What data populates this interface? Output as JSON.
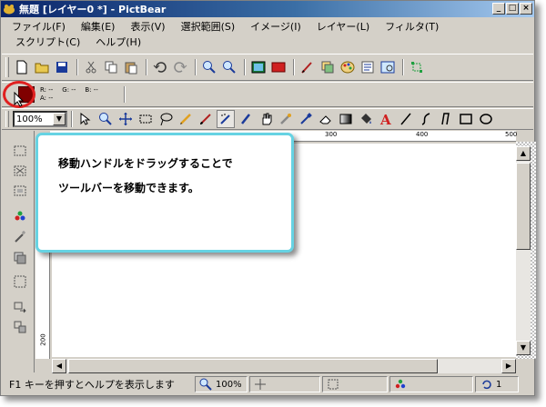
{
  "window": {
    "title": "無題 [レイヤー0 *] - PictBear",
    "buttons": {
      "minimize": "_",
      "maximize": "□",
      "close": "×"
    }
  },
  "menu": [
    "ファイル(F)",
    "編集(E)",
    "表示(V)",
    "選択範囲(S)",
    "イメージ(I)",
    "レイヤー(L)",
    "フィルタ(T)",
    "スクリプト(C)",
    "ヘルプ(H)"
  ],
  "color_panel": {
    "current_color": "#800000",
    "r_label": "R: --",
    "g_label": "G: --",
    "b_label": "B: --",
    "a_label": "A: --"
  },
  "zoom_combo": {
    "value": "100%"
  },
  "callout": {
    "line1": "移動ハンドルをドラッグすることで",
    "line2": "ツールバーを移動できます。"
  },
  "ruler": {
    "ticks": [
      "300",
      "400",
      "500"
    ],
    "vtick": "200"
  },
  "status": {
    "help_text": "F1 キーを押すとヘルプを表示します",
    "zoom": "100%",
    "undo_count": "1"
  },
  "colors": {
    "titlebar_start": "#0a246a",
    "accent_callout": "#66d3e3",
    "highlight": "#e02020"
  }
}
